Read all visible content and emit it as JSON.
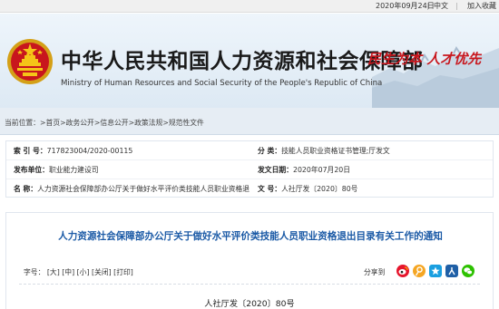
{
  "topbar": {
    "date": "2020年09月24日",
    "sep": "|",
    "lang": "中文",
    "favorite": "加入收藏"
  },
  "header": {
    "title_cn": "中华人民共和国人力资源和社会保障部",
    "title_en": "Ministry of Human Resources and Social Security of the People's Republic of China",
    "slogan": "民生为本  人才优先",
    "emblem_icon": "national-emblem-icon",
    "accent_red": "#c8161d"
  },
  "breadcrumb": {
    "label": "当前位置：",
    "items": [
      "首页",
      "政务公开",
      "信息公开",
      "政策法规",
      "规范性文件"
    ],
    "separator": ">"
  },
  "info": {
    "index_label": "索  引  号：",
    "index_value": "717823004/2020-00115",
    "category_label": "分        类：",
    "category_value": "技能人员职业资格证书管理;厅发文",
    "issuer_label": "发布单位：",
    "issuer_value": "职业能力建设司",
    "date_label": "发文日期：",
    "date_value": "2020年07月20日",
    "name_label": "名        称：",
    "name_value": "人力资源社会保障部办公厅关于做好水平评价类技能人员职业资格退",
    "docno_label": "文        号：",
    "docno_value": "人社厅发〔2020〕80号"
  },
  "article": {
    "title": "人力资源社会保障部办公厅关于做好水平评价类技能人员职业资格退出目录有关工作的通知",
    "font_size_label": "字号：",
    "size_large": "[大]",
    "size_medium": "[中]",
    "size_small": "[小]",
    "close": "[关闭]",
    "print": "[打印]",
    "share_label": "分享到",
    "share_icons": [
      "weibo-icon",
      "tencent-weibo-icon",
      "qzone-icon",
      "renren-icon",
      "wechat-icon"
    ],
    "doc_number": "人社厅发〔2020〕80号"
  }
}
